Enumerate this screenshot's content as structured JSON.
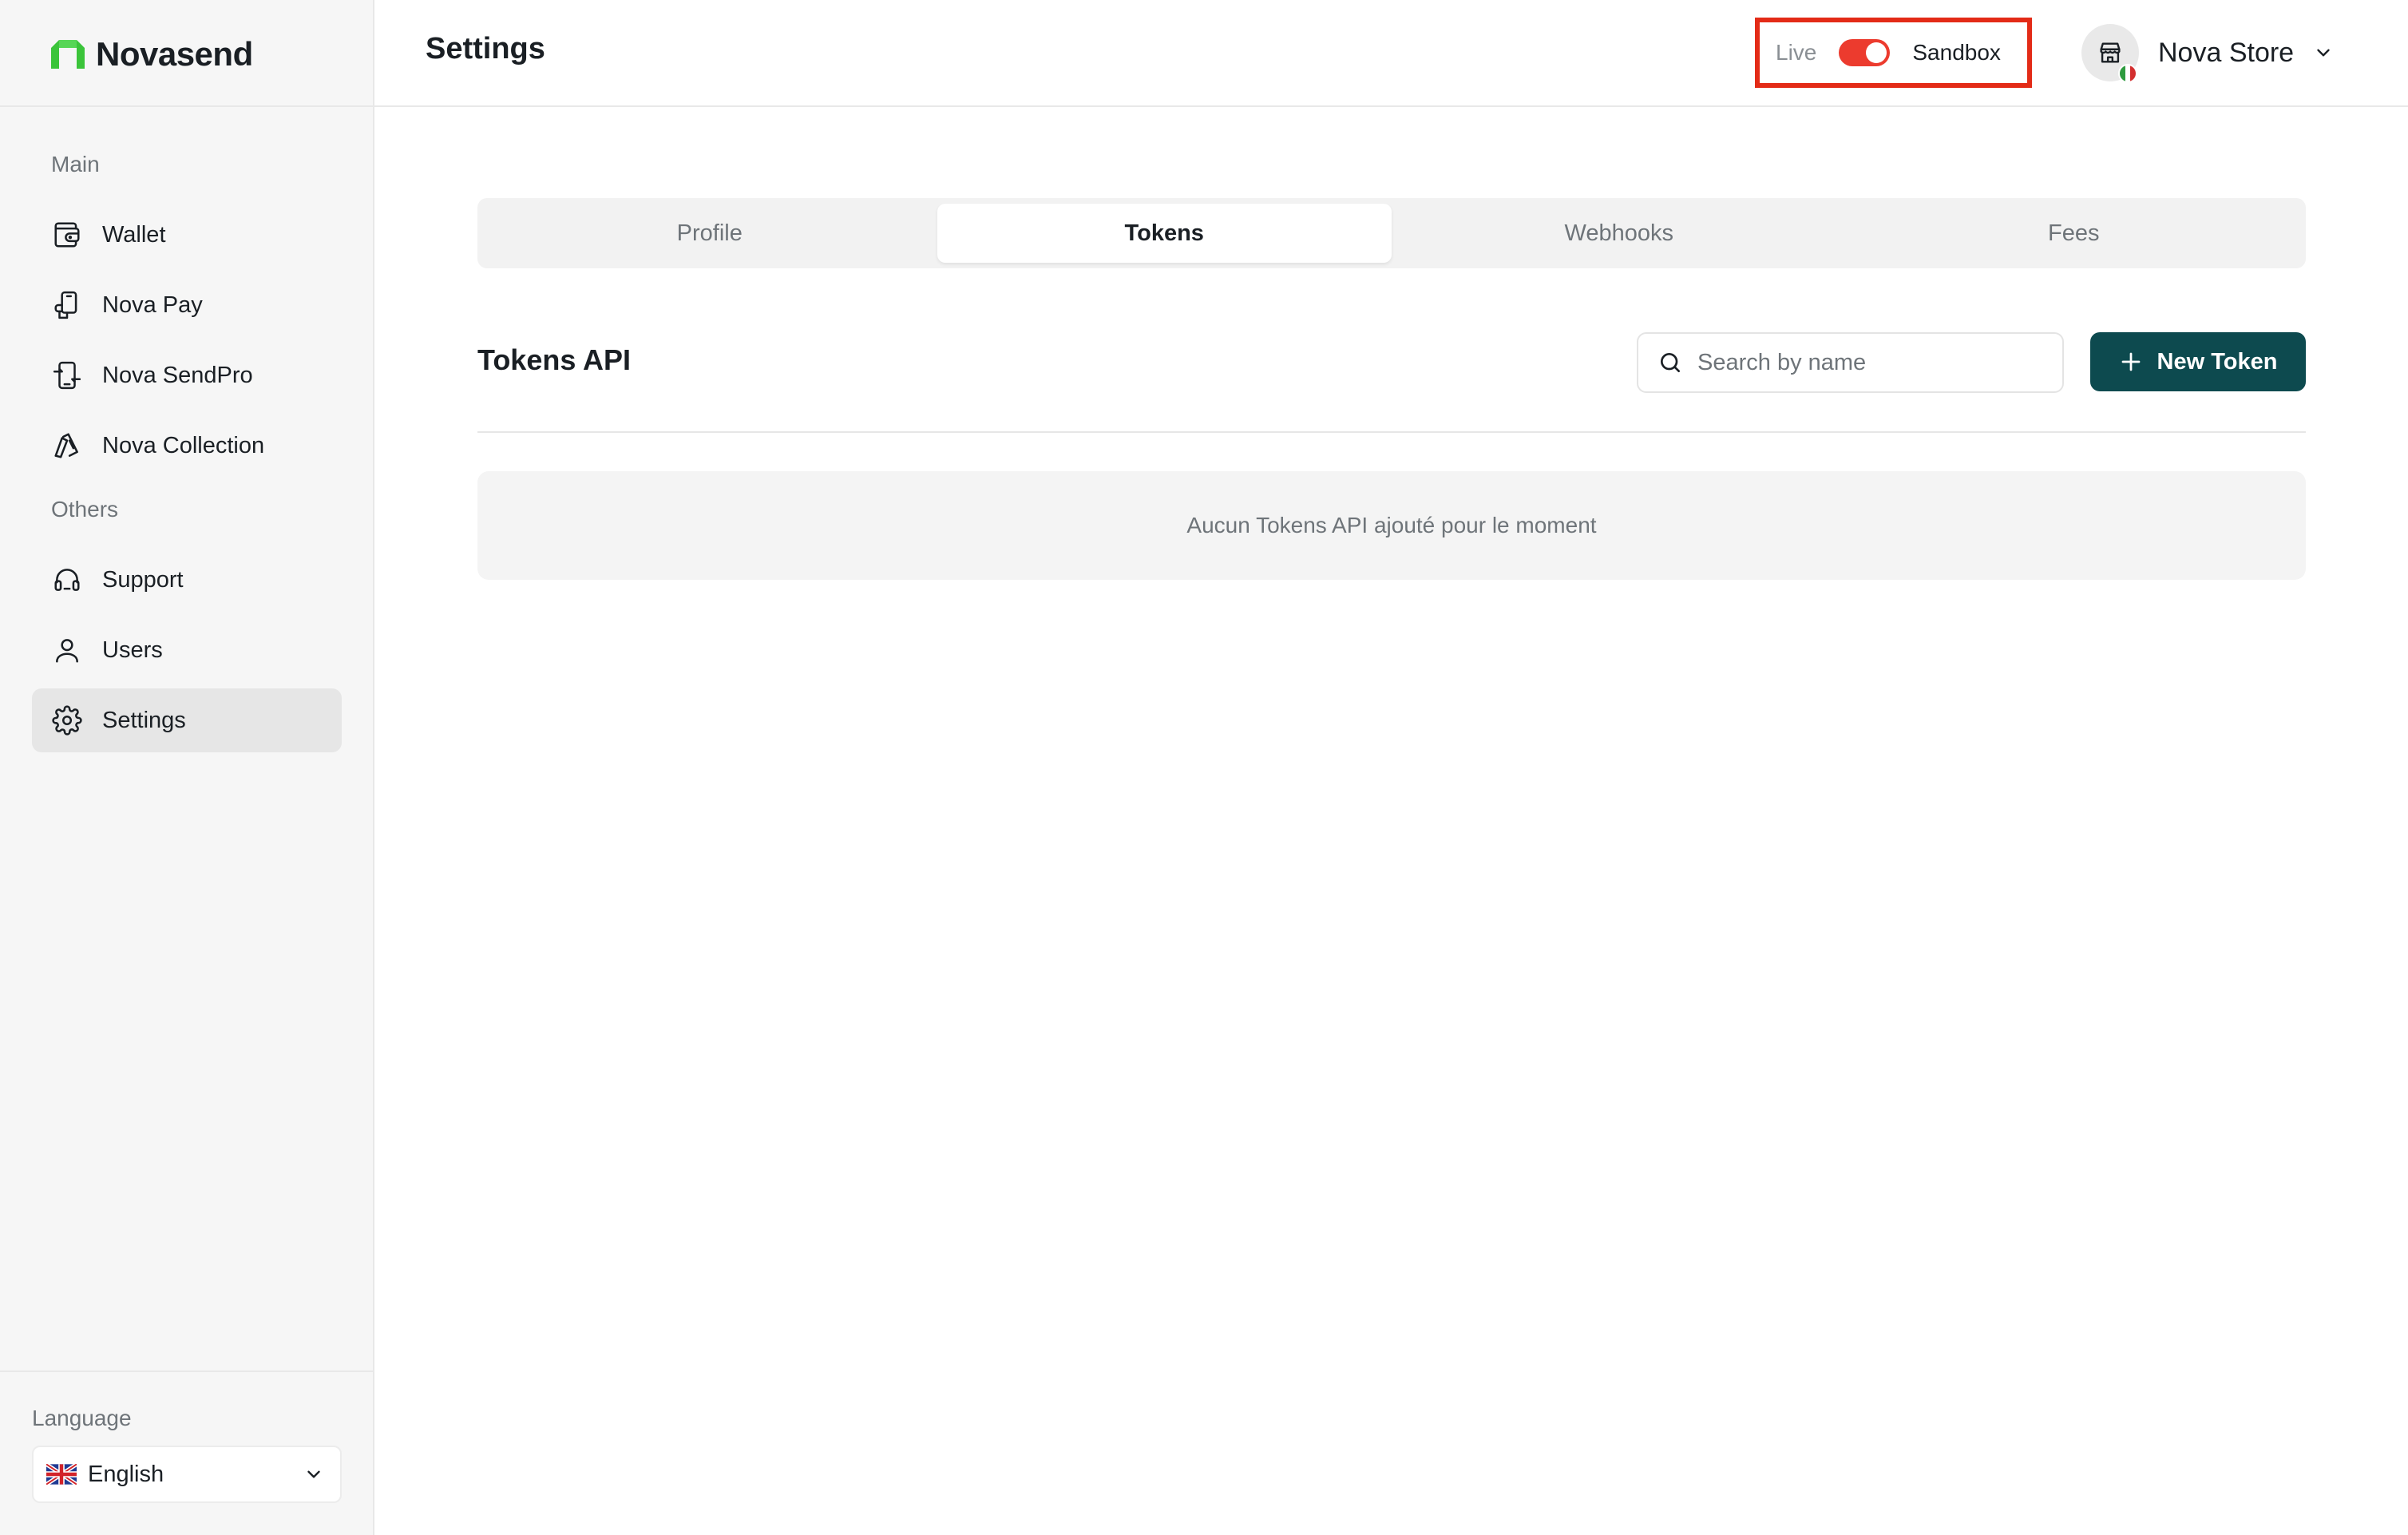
{
  "brand": {
    "name": "Novasend",
    "logo_color": "#3bc43a"
  },
  "sidebar": {
    "sections": [
      {
        "label": "Main",
        "items": [
          {
            "label": "Wallet",
            "icon": "wallet-icon"
          },
          {
            "label": "Nova Pay",
            "icon": "phone-pay-icon"
          },
          {
            "label": "Nova SendPro",
            "icon": "phone-send-icon"
          },
          {
            "label": "Nova Collection",
            "icon": "collection-icon"
          }
        ]
      },
      {
        "label": "Others",
        "items": [
          {
            "label": "Support",
            "icon": "headset-icon"
          },
          {
            "label": "Users",
            "icon": "user-icon"
          },
          {
            "label": "Settings",
            "icon": "gear-icon",
            "active": true
          }
        ]
      }
    ],
    "language": {
      "label": "Language",
      "value": "English",
      "flag": "uk-flag-icon"
    }
  },
  "header": {
    "title": "Settings",
    "mode": {
      "live_label": "Live",
      "sandbox_label": "Sandbox",
      "sandbox_on": true,
      "toggle_color": "#ec3b2e"
    },
    "account": {
      "name": "Nova Store",
      "flag": "italy-flag-icon"
    }
  },
  "tabs": [
    {
      "label": "Profile"
    },
    {
      "label": "Tokens",
      "active": true
    },
    {
      "label": "Webhooks"
    },
    {
      "label": "Fees"
    }
  ],
  "tokens": {
    "title": "Tokens API",
    "search_placeholder": "Search by name",
    "new_button_label": "New Token",
    "button_color": "#0d4a4f",
    "empty_message": "Aucun Tokens API ajouté pour le moment"
  },
  "highlight_color": "#e32b17"
}
